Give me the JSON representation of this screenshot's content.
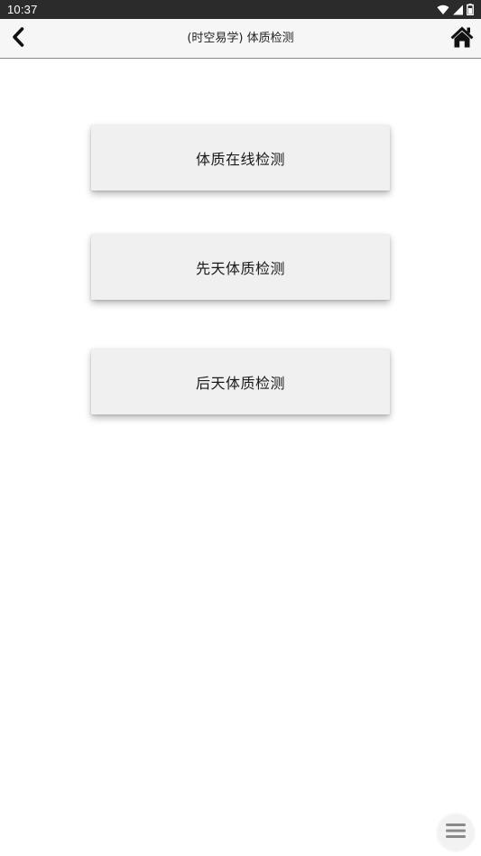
{
  "status_bar": {
    "time": "10:37",
    "icons": [
      "wifi-icon",
      "signal-icon",
      "battery-icon"
    ]
  },
  "toolbar": {
    "title": "(时空易学) 体质检测",
    "back_icon": "chevron-left-icon",
    "home_icon": "home-icon"
  },
  "menu": {
    "items": [
      {
        "label": "体质在线检测"
      },
      {
        "label": "先天体质检测"
      },
      {
        "label": "后天体质检测"
      }
    ]
  },
  "floating_button": {
    "icon": "hamburger-menu-icon"
  },
  "colors": {
    "status_bar_bg": "#2b2b2b",
    "toolbar_bg": "#f6f6f6",
    "button_bg": "#f0f0f0",
    "text": "#1a1a1a"
  }
}
